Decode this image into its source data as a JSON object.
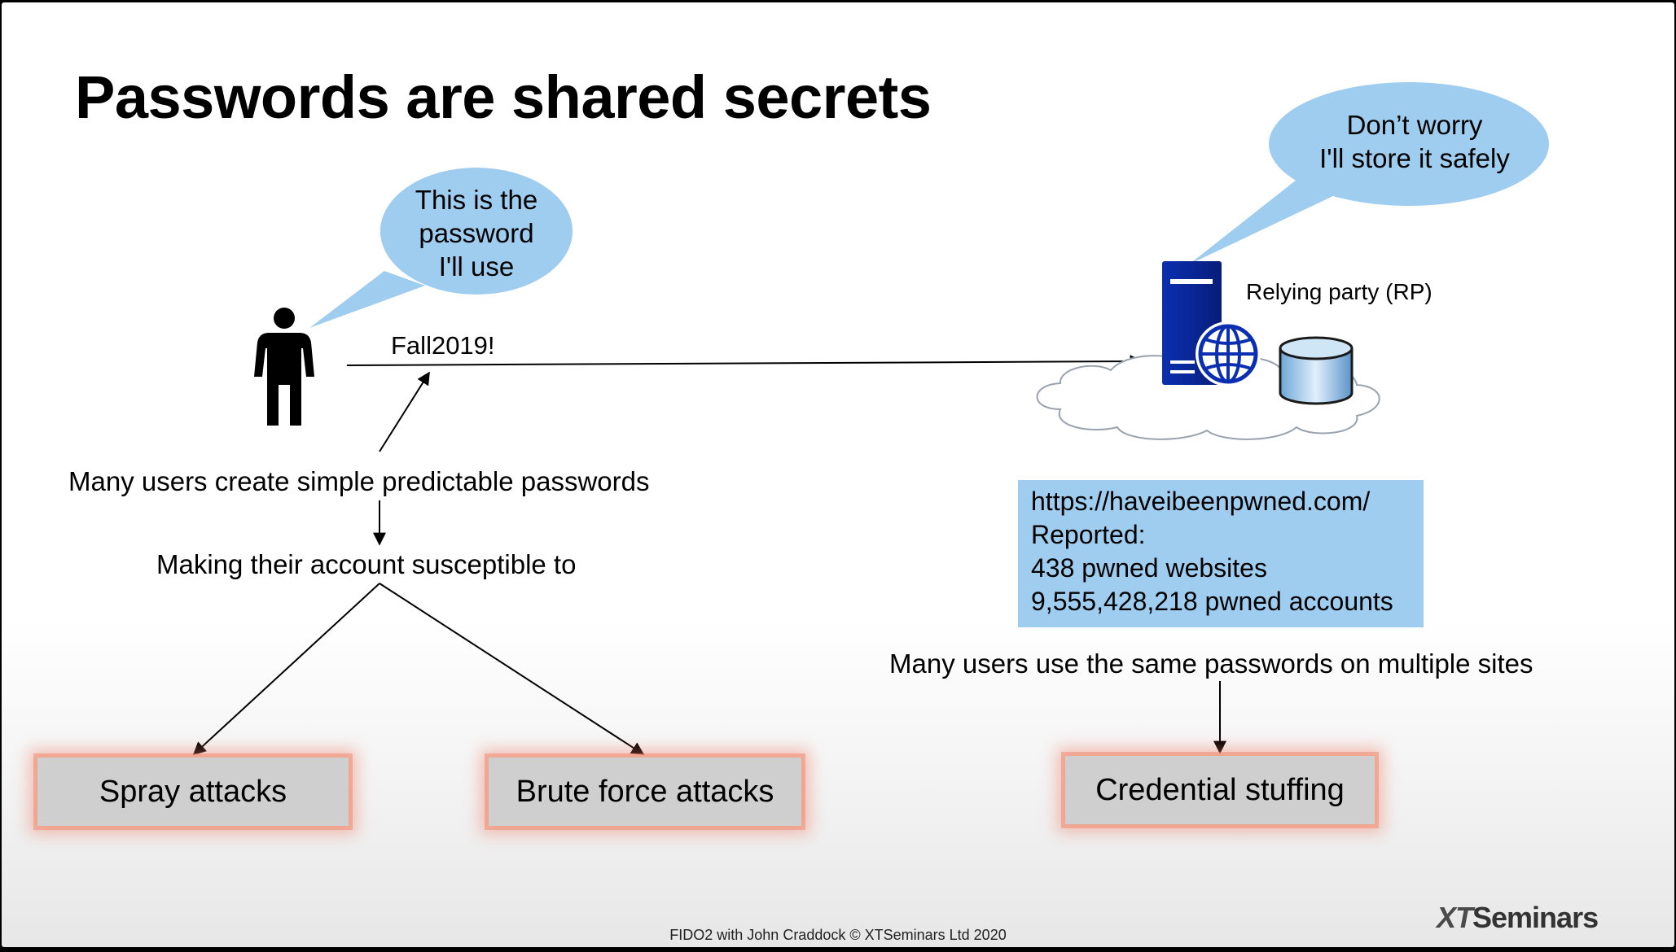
{
  "slide": {
    "title": "Passwords are shared secrets",
    "user_bubble": {
      "lines": [
        "This is the",
        "password",
        "I'll use"
      ]
    },
    "server_bubble": {
      "lines": [
        "Don’t worry",
        "I'll store it safely"
      ]
    },
    "password_label": "Fall2019!",
    "rp_label": "Relying party (RP)",
    "simple_passwords_text": "Many users create simple predictable passwords",
    "susceptible_text": "Making their account susceptible to",
    "info_box": {
      "url": "https://haveibeenpwned.com/",
      "reported": "Reported:",
      "websites": "438 pwned websites",
      "accounts": "9,555,428,218 pwned accounts"
    },
    "reuse_text": "Many users use the same passwords on multiple sites",
    "attacks": {
      "spray": "Spray attacks",
      "brute": "Brute force attacks",
      "stuffing": "Credential stuffing"
    },
    "footer": "FIDO2 with John Craddock © XTSeminars Ltd 2020",
    "logo": {
      "xt": "XT",
      "rest": "Seminars"
    },
    "colors": {
      "bubble": "#9fcdf0",
      "server": "#0a2a9c",
      "attack_glow": "#ee785f",
      "info_box": "#9fcdf0"
    }
  }
}
